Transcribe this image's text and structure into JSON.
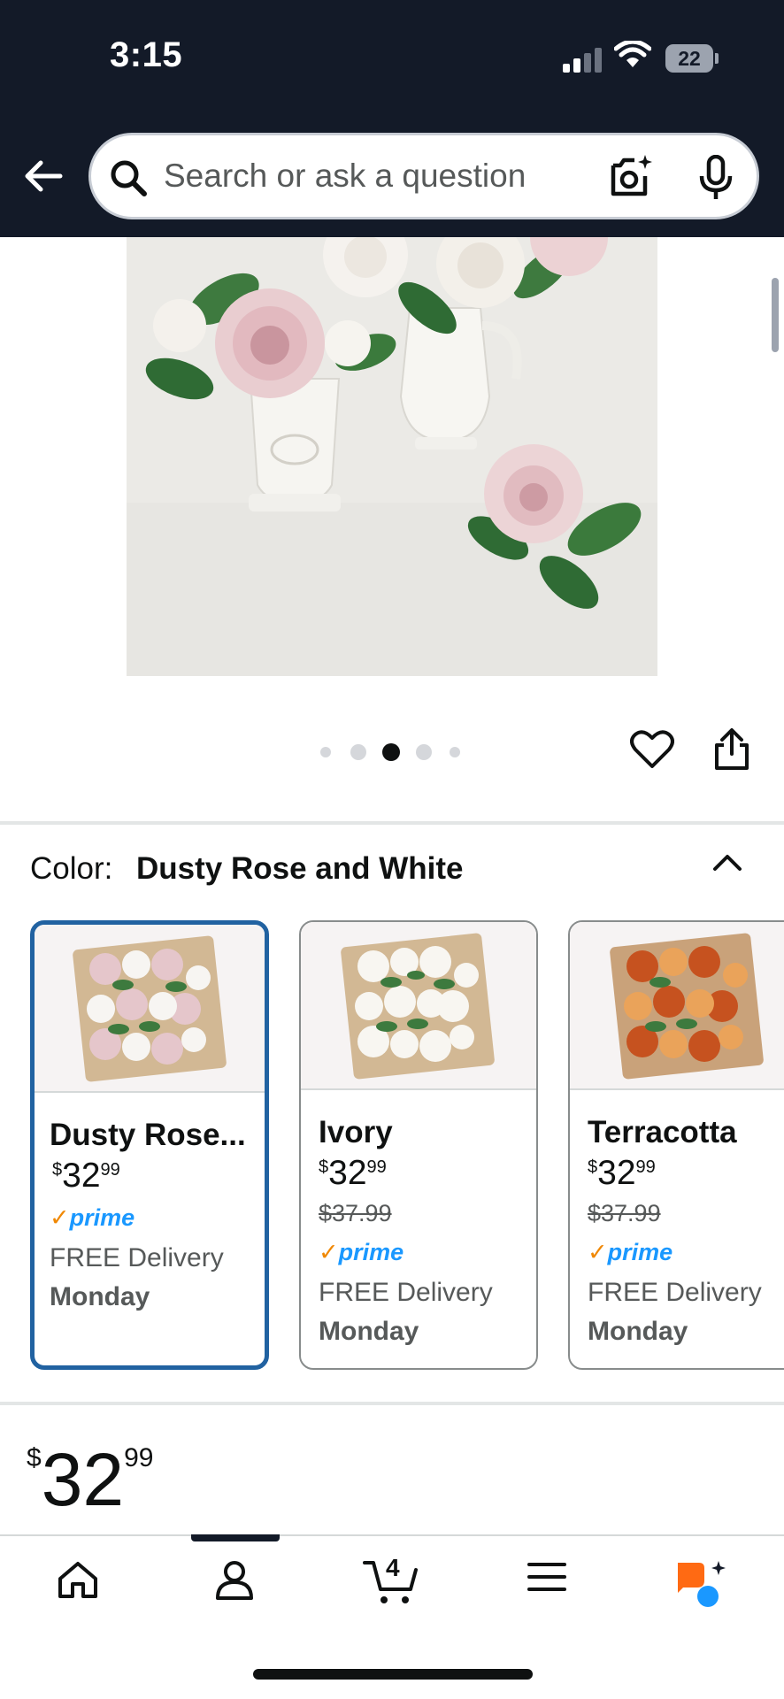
{
  "status_bar": {
    "time": "3:15",
    "battery": "22"
  },
  "header": {
    "search_placeholder": "Search or ask a question",
    "icons": [
      "back-arrow-icon",
      "search-icon",
      "camera-icon",
      "microphone-icon"
    ]
  },
  "gallery": {
    "image_count": 5,
    "active_index": 2
  },
  "color_selector": {
    "label": "Color:",
    "selected_value": "Dusty Rose and White",
    "options": [
      {
        "name": "Dusty Rose...",
        "currency": "$",
        "price_whole": "32",
        "price_fraction": "99",
        "list_price": "",
        "prime": "prime",
        "delivery": "FREE Delivery",
        "delivery_day": "Monday",
        "selected": true
      },
      {
        "name": "Ivory",
        "currency": "$",
        "price_whole": "32",
        "price_fraction": "99",
        "list_price": "$37.99",
        "prime": "prime",
        "delivery": "FREE Delivery",
        "delivery_day": "Monday",
        "selected": false
      },
      {
        "name": "Terracotta",
        "currency": "$",
        "price_whole": "32",
        "price_fraction": "99",
        "list_price": "$37.99",
        "prime": "prime",
        "delivery": "FREE Delivery",
        "delivery_day": "Monday",
        "selected": false
      }
    ]
  },
  "price": {
    "currency": "$",
    "whole": "32",
    "fraction": "99"
  },
  "bottom_nav": {
    "cart_count": "4",
    "items": [
      "home-icon",
      "account-icon",
      "cart-icon",
      "menu-icon",
      "rufus-assistant-icon"
    ]
  },
  "colors": {
    "header_bg": "#131a28",
    "selected_border": "#2162a1",
    "prime_blue": "#1a98ff",
    "prime_check": "#f08804",
    "assistant_orange": "#ff6a13"
  }
}
